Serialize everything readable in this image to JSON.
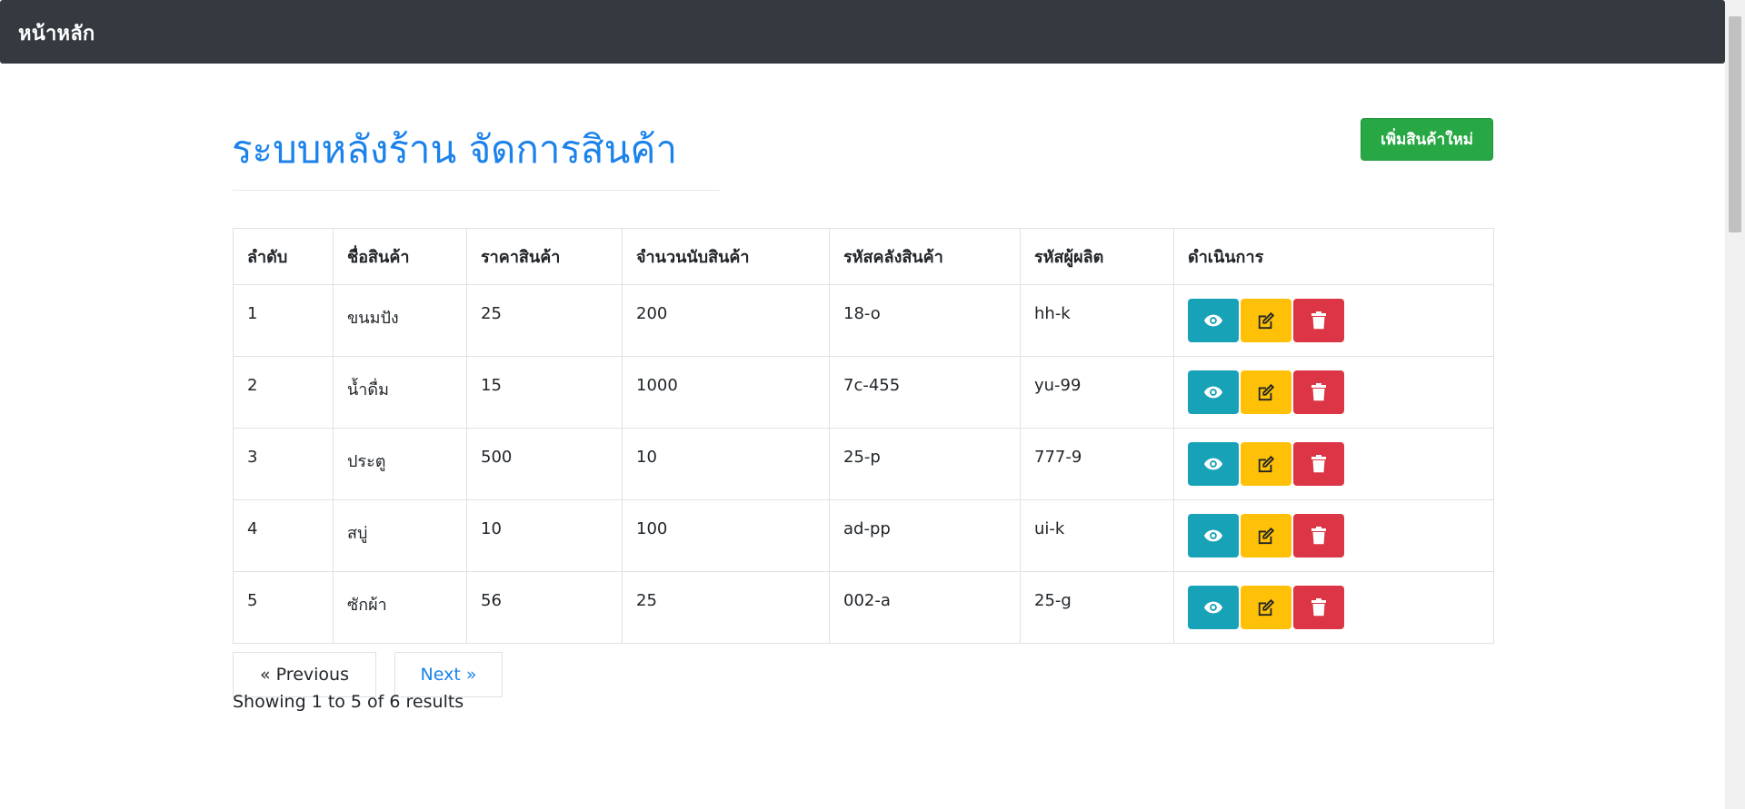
{
  "navbar": {
    "brand": "หน้าหลัก"
  },
  "page": {
    "title": "ระบบหลังร้าน จัดการสินค้า",
    "add_button_label": "เพิ่มสินค้าใหม่"
  },
  "table": {
    "headers": [
      "ลำดับ",
      "ชื่อสินค้า",
      "ราคาสินค้า",
      "จำนวนนับสินค้า",
      "รหัสคลังสินค้า",
      "รหัสผู้ผลิต",
      "ดำเนินการ"
    ],
    "rows": [
      [
        "1",
        "ขนมปัง",
        "25",
        "200",
        "18-o",
        "hh-k"
      ],
      [
        "2",
        "น้ำดื่ม",
        "15",
        "1000",
        "7c-455",
        "yu-99"
      ],
      [
        "3",
        "ประตู",
        "500",
        "10",
        "25-p",
        "777-9"
      ],
      [
        "4",
        "สบู่",
        "10",
        "100",
        "ad-pp",
        "ui-k"
      ],
      [
        "5",
        "ซักผ้า",
        "56",
        "25",
        "002-a",
        "25-g"
      ]
    ],
    "action_icons": [
      "eye-icon",
      "edit-icon",
      "trash-icon"
    ]
  },
  "pagination": {
    "previous_label": "« Previous",
    "next_label": "Next »",
    "results_text": "Showing 1 to 5 of 6 results"
  },
  "colors": {
    "navbar": "#343a40",
    "title": "#1a82ea",
    "add_button": "#28a745",
    "view_button": "#17a2b8",
    "edit_button": "#ffc107",
    "delete_button": "#dc3545"
  }
}
